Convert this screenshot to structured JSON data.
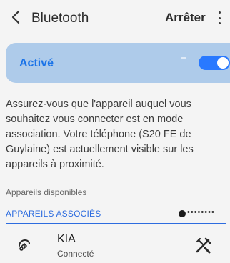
{
  "header": {
    "title": "Bluetooth",
    "stop_label": "Arrêter",
    "back_icon": "chevron-left-icon",
    "more_icon": "more-vertical-icon"
  },
  "toggle": {
    "label": "Activé",
    "state": "on",
    "accent_color": "#2979ff"
  },
  "description": "Assurez-vous que l'appareil auquel vous souhaitez vous connecter est en mode association. Votre téléphone (S20 FE de Guylaine) est actuellement visible sur les appareils à proximité.",
  "available_devices": {
    "label": "Appareils disponibles"
  },
  "paired_devices": {
    "label": "APPAREILS ASSOCIÉS",
    "slider_icon": "slider-dots-icon",
    "items": [
      {
        "name": "KIA",
        "status": "Connecté",
        "icon": "car-bluetooth-icon",
        "settings_icon": "tools-icon"
      }
    ]
  }
}
